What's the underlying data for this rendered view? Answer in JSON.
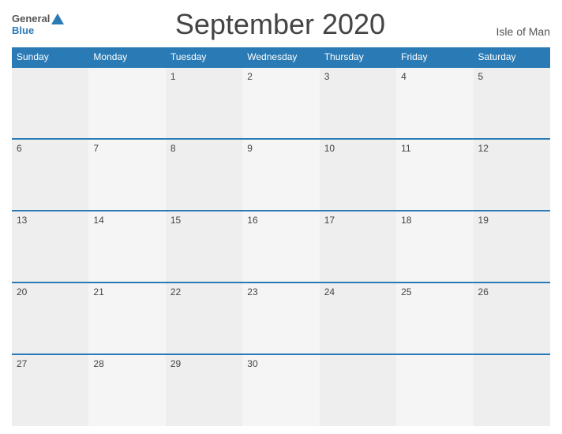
{
  "header": {
    "logo_general": "General",
    "logo_blue": "Blue",
    "title": "September 2020",
    "region": "Isle of Man"
  },
  "days_of_week": [
    "Sunday",
    "Monday",
    "Tuesday",
    "Wednesday",
    "Thursday",
    "Friday",
    "Saturday"
  ],
  "weeks": [
    [
      "",
      "",
      "1",
      "2",
      "3",
      "4",
      "5"
    ],
    [
      "6",
      "7",
      "8",
      "9",
      "10",
      "11",
      "12"
    ],
    [
      "13",
      "14",
      "15",
      "16",
      "17",
      "18",
      "19"
    ],
    [
      "20",
      "21",
      "22",
      "23",
      "24",
      "25",
      "26"
    ],
    [
      "27",
      "28",
      "29",
      "30",
      "",
      "",
      ""
    ]
  ]
}
